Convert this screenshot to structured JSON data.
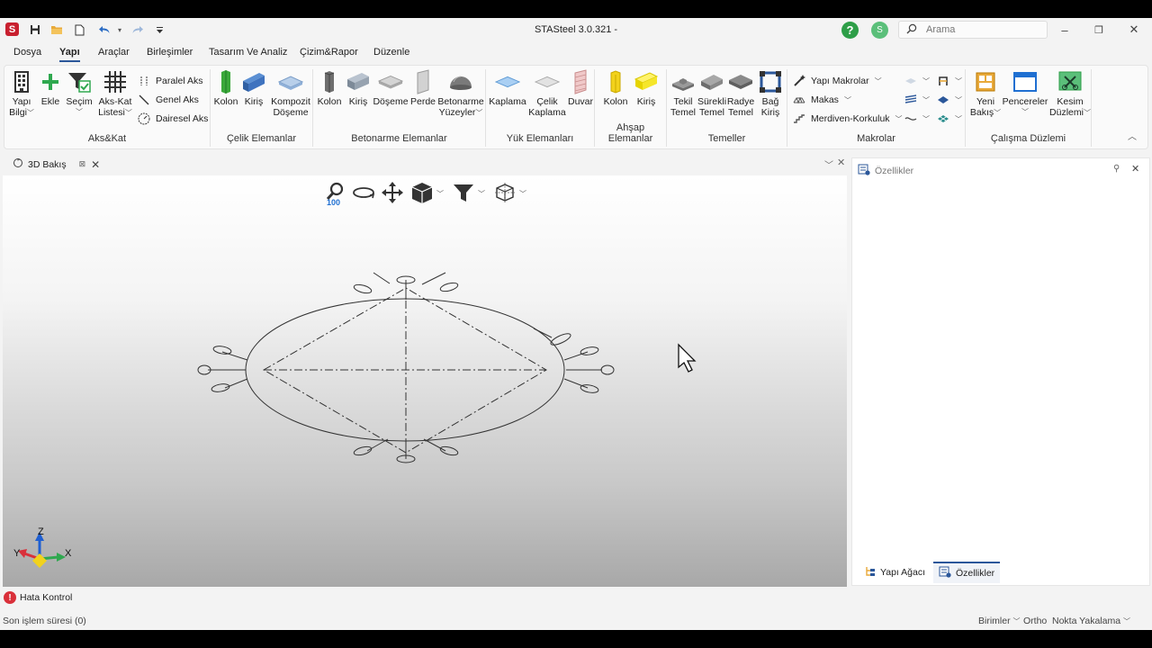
{
  "window": {
    "title": "STASteel 3.0.321 -",
    "app_logo": "S",
    "help_label": "?",
    "user_initial": "S",
    "search_placeholder": "Arama",
    "minimize_label": "–",
    "maximize_label": "❐",
    "close_label": "✕"
  },
  "menu": {
    "tabs": [
      "Dosya",
      "Yapı",
      "Araçlar",
      "Birleşimler",
      "Tasarım Ve Analiz",
      "Çizim&Rapor",
      "Düzenle"
    ],
    "active": "Yapı"
  },
  "ribbon": {
    "groups": {
      "akskat": "Aks&Kat",
      "celik": "Çelik Elemanlar",
      "betonarme": "Betonarme Elemanlar",
      "yuk": "Yük Elemanları",
      "ahsap": "Ahşap Elemanlar",
      "temeller": "Temeller",
      "makrolar": "Makrolar",
      "calisma": "Çalışma Düzlemi"
    },
    "akskat": {
      "yapi_bilgi": [
        "Yapı",
        "Bilgi"
      ],
      "ekle": "Ekle",
      "secim": "Seçim",
      "aks_kat_listesi": [
        "Aks-Kat",
        "Listesi"
      ],
      "paralel_aks": "Paralel Aks",
      "genel_aks": "Genel Aks",
      "dairesel_aks": "Dairesel Aks"
    },
    "celik": {
      "kolon": "Kolon",
      "kiris": "Kiriş",
      "kompozit_doseme": [
        "Kompozit",
        "Döşeme"
      ]
    },
    "betonarme": {
      "kolon": "Kolon",
      "kiris": "Kiriş",
      "doseme": "Döşeme",
      "perde": "Perde",
      "betonarme_yuzeyler": [
        "Betonarme",
        "Yüzeyler"
      ]
    },
    "yuk": {
      "kaplama": "Kaplama",
      "celik_kaplama": [
        "Çelik",
        "Kaplama"
      ],
      "duvar": "Duvar"
    },
    "ahsap": {
      "kolon": "Kolon",
      "kiris": "Kiriş"
    },
    "temeller": {
      "tekil_temel": [
        "Tekil",
        "Temel"
      ],
      "surekli_temel": [
        "Sürekli",
        "Temel"
      ],
      "radye_temel": [
        "Radye",
        "Temel"
      ],
      "bag_kiris": [
        "Bağ",
        "Kiriş"
      ]
    },
    "makrolar": {
      "yapi_makrolar": "Yapı Makrolar",
      "makas": "Makas",
      "merdiven_korkuluk": "Merdiven-Korkuluk"
    },
    "calisma": {
      "yeni_bakis": [
        "Yeni",
        "Bakış"
      ],
      "pencereler": "Pencereler",
      "kesim_duzlemi": [
        "Kesim",
        "Düzlemi"
      ]
    }
  },
  "view": {
    "tab_label": "3D Bakış",
    "zoom_badge": "100",
    "axis_labels": {
      "z": "Z",
      "x": "X",
      "y": "Y"
    }
  },
  "panel": {
    "title": "Özellikler",
    "tabs": [
      "Yapı Ağacı",
      "Özellikler"
    ]
  },
  "error_bar": {
    "label": "Hata Kontrol"
  },
  "status": {
    "last_op": "Son işlem süresi (0)",
    "units": "Birimler",
    "ortho": "Ortho",
    "snap": "Nokta Yakalama"
  },
  "colors": {
    "accent": "#2b579a",
    "logo_red": "#c8202f",
    "help_green": "#2e9e48",
    "error_red": "#d9303a"
  }
}
